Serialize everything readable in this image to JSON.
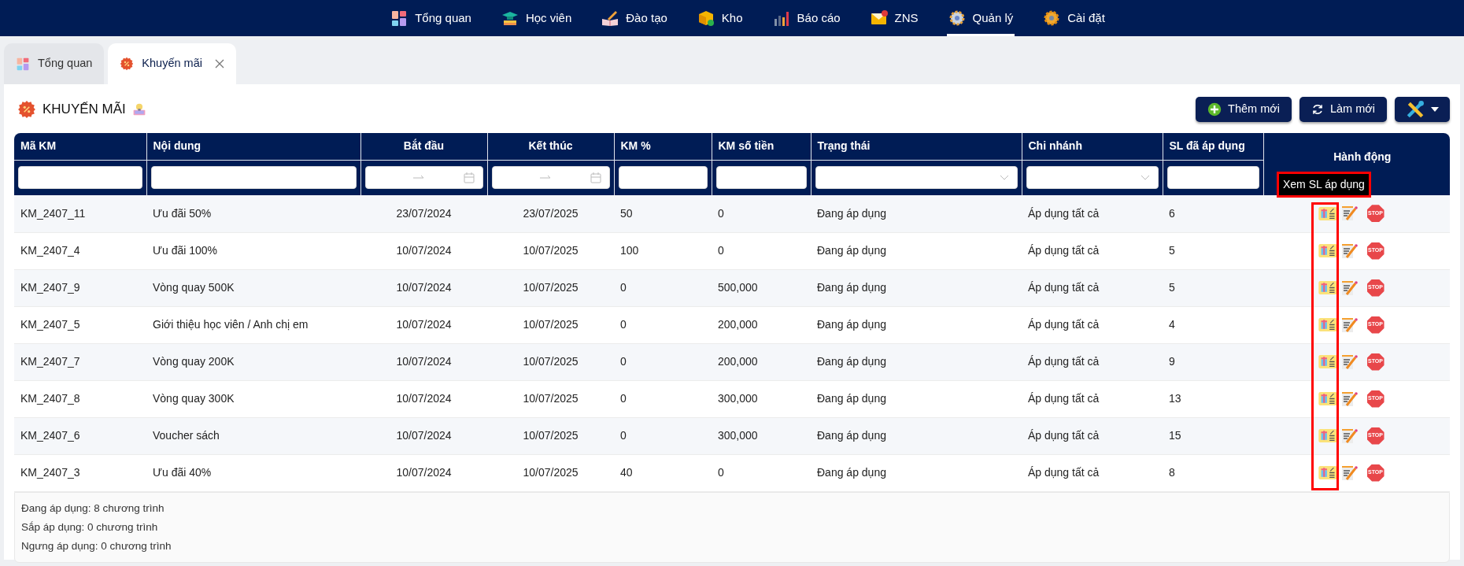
{
  "nav": {
    "items": [
      {
        "label": "Tổng quan",
        "selected": false
      },
      {
        "label": "Học viên",
        "selected": false
      },
      {
        "label": "Đào tạo",
        "selected": false
      },
      {
        "label": "Kho",
        "selected": false
      },
      {
        "label": "Báo cáo",
        "selected": false
      },
      {
        "label": "ZNS",
        "selected": false
      },
      {
        "label": "Quản lý",
        "selected": true
      },
      {
        "label": "Cài đặt",
        "selected": false
      }
    ]
  },
  "tabs": [
    {
      "label": "Tổng quan",
      "selected": false,
      "closable": false
    },
    {
      "label": "Khuyến mãi",
      "selected": true,
      "closable": true
    }
  ],
  "page": {
    "title": "KHUYẾN MÃI"
  },
  "toolbar": {
    "buttons": [
      {
        "kind": "add",
        "label": "Thêm mới"
      },
      {
        "kind": "refresh",
        "label": "Làm mới"
      },
      {
        "kind": "tools"
      }
    ]
  },
  "table": {
    "columns": [
      {
        "label": "Mã KM",
        "kind": "text"
      },
      {
        "label": "Nội dung",
        "kind": "text"
      },
      {
        "label": "Bắt đầu",
        "kind": "date"
      },
      {
        "label": "Kết thúc",
        "kind": "date"
      },
      {
        "label": "KM %",
        "kind": "text"
      },
      {
        "label": "KM số tiền",
        "kind": "text"
      },
      {
        "label": "Trạng thái",
        "kind": "select"
      },
      {
        "label": "Chi nhánh",
        "kind": "select"
      },
      {
        "label": "SL đã áp dụng",
        "kind": "text"
      },
      {
        "label": "Hành động",
        "kind": "actions"
      }
    ],
    "rows": [
      {
        "stop_label": "STOP",
        "cells": [
          "KM_2407_11",
          "Ưu đãi 50%",
          "23/07/2024",
          "23/07/2025",
          "50",
          "0",
          "Đang áp dụng",
          "Áp dụng tất cả",
          "6"
        ]
      },
      {
        "stop_label": "STOP",
        "cells": [
          "KM_2407_4",
          "Ưu đãi 100%",
          "10/07/2024",
          "10/07/2025",
          "100",
          "0",
          "Đang áp dụng",
          "Áp dụng tất cả",
          "5"
        ]
      },
      {
        "stop_label": "STOP",
        "cells": [
          "KM_2407_9",
          "Vòng quay 500K",
          "10/07/2024",
          "10/07/2025",
          "0",
          "500,000",
          "Đang áp dụng",
          "Áp dụng tất cả",
          "5"
        ]
      },
      {
        "stop_label": "STOP",
        "cells": [
          "KM_2407_5",
          "Giới thiệu học viên / Anh chị em",
          "10/07/2024",
          "10/07/2025",
          "0",
          "200,000",
          "Đang áp dụng",
          "Áp dụng tất cả",
          "4"
        ]
      },
      {
        "stop_label": "STOP",
        "cells": [
          "KM_2407_7",
          "Vòng quay 200K",
          "10/07/2024",
          "10/07/2025",
          "0",
          "200,000",
          "Đang áp dụng",
          "Áp dụng tất cả",
          "9"
        ]
      },
      {
        "stop_label": "STOP",
        "cells": [
          "KM_2407_8",
          "Vòng quay 300K",
          "10/07/2024",
          "10/07/2025",
          "0",
          "300,000",
          "Đang áp dụng",
          "Áp dụng tất cả",
          "13"
        ]
      },
      {
        "stop_label": "STOP",
        "cells": [
          "KM_2407_6",
          "Voucher sách",
          "10/07/2024",
          "10/07/2025",
          "0",
          "300,000",
          "Đang áp dụng",
          "Áp dụng tất cả",
          "15"
        ]
      },
      {
        "stop_label": "STOP",
        "cells": [
          "KM_2407_3",
          "Ưu đãi 40%",
          "10/07/2024",
          "10/07/2025",
          "40",
          "0",
          "Đang áp dụng",
          "Áp dụng tất cả",
          "8"
        ]
      }
    ],
    "tooltip": "Xem SL áp dụng"
  },
  "summary": [
    "Đang áp dụng: 8 chương trình",
    "Sắp áp dụng: 0 chương trình",
    "Ngưng áp dụng: 0 chương trình"
  ]
}
